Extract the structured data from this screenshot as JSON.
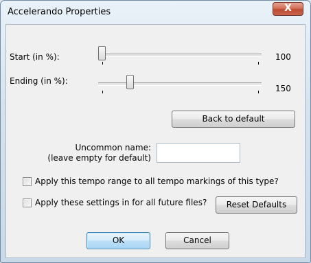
{
  "window": {
    "title": "Accelerando Properties",
    "close_glyph": "X"
  },
  "start": {
    "label": "Start (in %):",
    "value": "100",
    "slider_position": 0.0
  },
  "ending": {
    "label": "Ending (in %):",
    "value": "150",
    "slider_position": 0.18
  },
  "back_to_default": {
    "label": "Back to default"
  },
  "uncommon_name": {
    "label_line1": "Uncommon name:",
    "label_line2": "(leave empty for default)",
    "value": ""
  },
  "apply_range": {
    "label": "Apply this tempo range to all tempo markings of this type?",
    "checked": false
  },
  "apply_future": {
    "label": "Apply these settings in for all future files?",
    "checked": false
  },
  "reset_defaults": {
    "label": "Reset Defaults"
  },
  "ok": {
    "label": "OK"
  },
  "cancel": {
    "label": "Cancel"
  },
  "colors": {
    "close_button": "#c8654c",
    "default_button_border": "#3c7fb1",
    "dialog_background": "#f0f0f0"
  }
}
